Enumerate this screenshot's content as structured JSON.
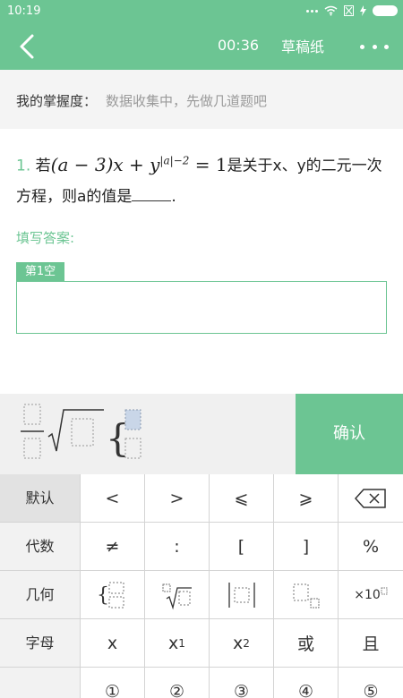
{
  "status_bar": {
    "time": "10:19"
  },
  "header": {
    "timer": "00:36",
    "draft_label": "草稿纸"
  },
  "mastery": {
    "label": "我的掌握度：",
    "value": "数据收集中，先做几道题吧"
  },
  "question": {
    "number": "1.",
    "prefix": "若",
    "equation_part1": "(a − 3)x + y",
    "exponent": "|a|−2",
    "equation_part2": " = 1",
    "text_after": "是关于x、y的二元一次方程，则a的值是",
    "text_end": "."
  },
  "answer": {
    "fill_label": "填写答案:",
    "blank_tab": "第1空"
  },
  "confirm_label": "确认",
  "keyboard": {
    "categories": [
      "默认",
      "代数",
      "几何",
      "字母"
    ],
    "rows": [
      [
        "<",
        ">",
        "⩽",
        "⩾"
      ],
      [
        "≠",
        ":",
        "[",
        "]",
        "%"
      ],
      [
        "",
        "",
        "",
        "",
        "×10"
      ],
      [
        "x",
        "x",
        "x",
        "或",
        "且"
      ],
      [
        "①",
        "②",
        "③",
        "④",
        "⑤"
      ]
    ],
    "subs": {
      "x1": "1",
      "x2": "2"
    }
  },
  "colors": {
    "accent": "#6cc593"
  }
}
